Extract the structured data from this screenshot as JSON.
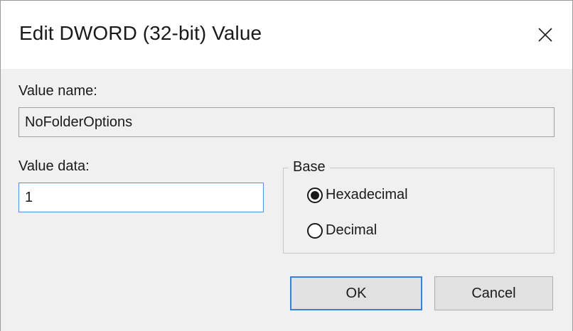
{
  "dialog": {
    "title": "Edit DWORD (32-bit) Value",
    "close_icon": "close-icon"
  },
  "value_name": {
    "label": "Value name:",
    "value": "NoFolderOptions"
  },
  "value_data": {
    "label": "Value data:",
    "value": "1"
  },
  "base": {
    "legend": "Base",
    "options": [
      {
        "label": "Hexadecimal",
        "selected": true
      },
      {
        "label": "Decimal",
        "selected": false
      }
    ]
  },
  "buttons": {
    "ok_label": "OK",
    "cancel_label": "Cancel"
  },
  "colors": {
    "dialog_background": "#f0f0f0",
    "title_background": "#ffffff",
    "focus_accent": "#3c7fd6"
  }
}
